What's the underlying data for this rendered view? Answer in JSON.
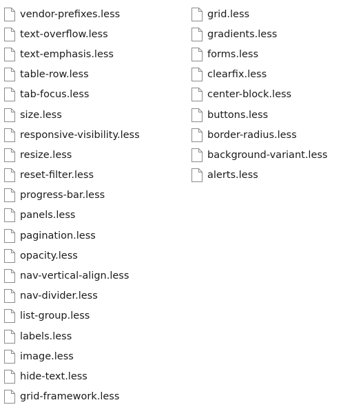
{
  "icon": "generic-file-icon",
  "colors": {
    "background": "#ffffff",
    "text": "#1a1a1a",
    "icon_outline": "#8a8a8a",
    "icon_fill": "#ffffff"
  },
  "columns": [
    {
      "files": [
        "vendor-prefixes.less",
        "text-overflow.less",
        "text-emphasis.less",
        "table-row.less",
        "tab-focus.less",
        "size.less",
        "responsive-visibility.less",
        "resize.less",
        "reset-filter.less",
        "progress-bar.less",
        "panels.less",
        "pagination.less",
        "opacity.less",
        "nav-vertical-align.less",
        "nav-divider.less",
        "list-group.less",
        "labels.less",
        "image.less",
        "hide-text.less",
        "grid-framework.less"
      ]
    },
    {
      "files": [
        "grid.less",
        "gradients.less",
        "forms.less",
        "clearfix.less",
        "center-block.less",
        "buttons.less",
        "border-radius.less",
        "background-variant.less",
        "alerts.less"
      ]
    }
  ]
}
